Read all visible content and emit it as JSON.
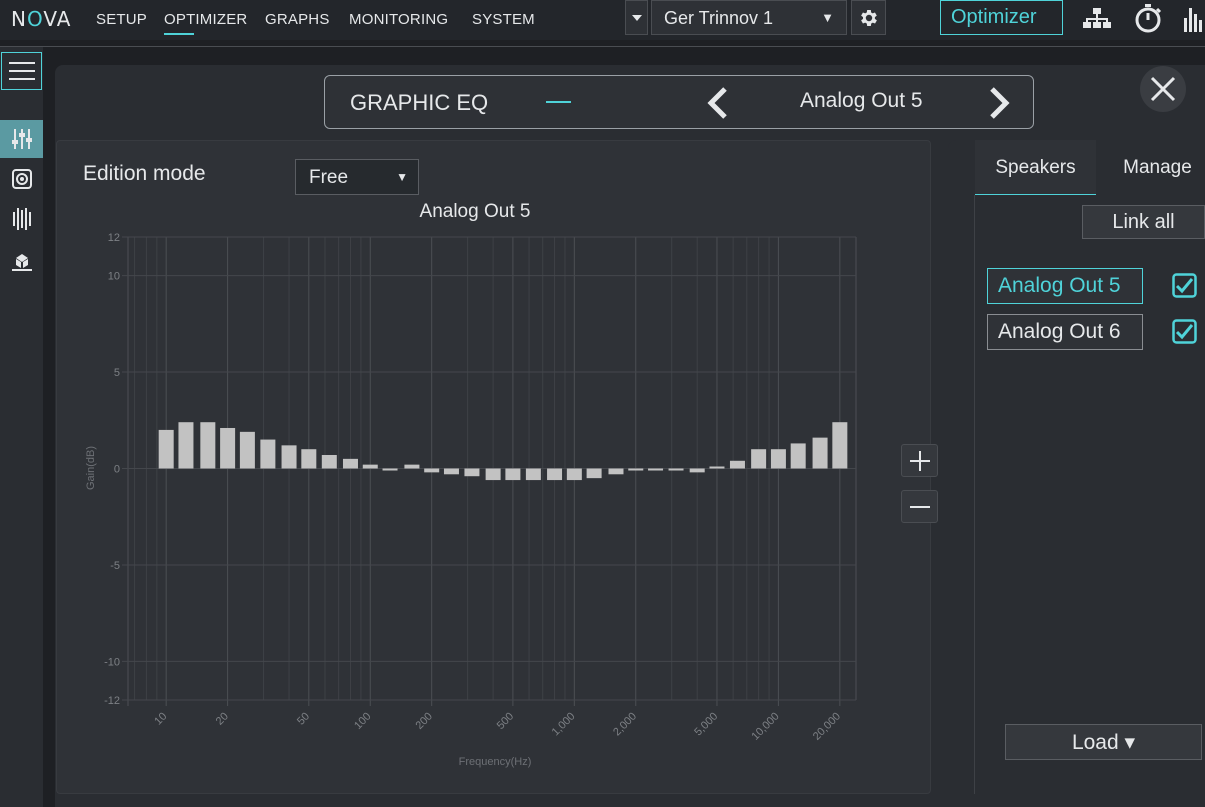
{
  "app": {
    "logo_pre": "N",
    "logo_o": "O",
    "logo_post": "VA"
  },
  "nav": [
    "SETUP",
    "OPTIMIZER",
    "GRAPHS",
    "MONITORING",
    "SYSTEM"
  ],
  "device": {
    "selected": "Ger Trinnov 1",
    "arrow": "▼"
  },
  "toolbar": {
    "optimizer_label": "Optimizer"
  },
  "header": {
    "title": "GRAPHIC EQ",
    "channel": "Analog Out 5"
  },
  "edition": {
    "label": "Edition mode",
    "mode": "Free",
    "arrow": "▼"
  },
  "tabs": {
    "speakers": "Speakers",
    "manage": "Manage"
  },
  "link_all": "Link all",
  "speakers": [
    {
      "name": "Analog Out 5",
      "checked": true
    },
    {
      "name": "Analog Out 6",
      "checked": true
    }
  ],
  "load": {
    "label": "Load",
    "arrow": "▾"
  },
  "colors": {
    "accent": "#4fd3d9",
    "bar": "#c2c2c2",
    "active_tool": "#5b9aa2"
  },
  "chart_data": {
    "type": "bar",
    "title": "Analog Out 5",
    "xlabel": "Frequency(Hz)",
    "ylabel": "Gain(dB)",
    "x_scale": "log",
    "xlim": [
      6.5,
      24000
    ],
    "ylim": [
      -12,
      12
    ],
    "y_ticks": [
      12,
      10,
      5,
      0,
      -5,
      -10,
      -12
    ],
    "x_ticks": [
      10,
      20,
      50,
      100,
      200,
      500,
      1000,
      2000,
      5000,
      10000,
      20000
    ],
    "x_tick_labels": [
      "10",
      "20",
      "50",
      "100",
      "200",
      "500",
      "1,000",
      "2,000",
      "5,000",
      "10,000",
      "20,000"
    ],
    "grid": true,
    "categories": [
      10,
      12.5,
      16,
      20,
      25,
      31.5,
      40,
      50,
      63,
      80,
      100,
      125,
      160,
      200,
      250,
      315,
      400,
      500,
      630,
      800,
      1000,
      1250,
      1600,
      2000,
      2500,
      3150,
      4000,
      5000,
      6300,
      8000,
      10000,
      12500,
      16000,
      20000
    ],
    "values": [
      2.0,
      2.4,
      2.4,
      2.1,
      1.9,
      1.5,
      1.2,
      1.0,
      0.7,
      0.5,
      0.2,
      -0.1,
      0.2,
      -0.2,
      -0.3,
      -0.4,
      -0.6,
      -0.6,
      -0.6,
      -0.6,
      -0.6,
      -0.5,
      -0.3,
      -0.1,
      -0.1,
      -0.1,
      -0.2,
      0.1,
      0.4,
      1.0,
      1.0,
      1.3,
      1.6,
      2.4
    ]
  }
}
